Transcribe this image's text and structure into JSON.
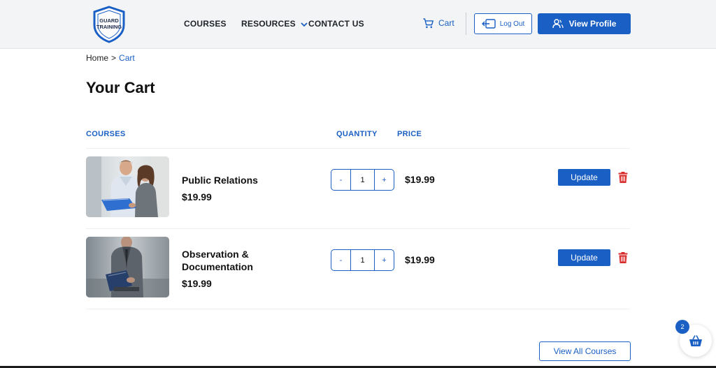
{
  "header": {
    "logo_text_top": "GUARD",
    "logo_text_bottom": "TRAINING",
    "nav": {
      "courses": "COURSES",
      "resources": "RESOURCES",
      "contact": "CONTACT US"
    },
    "cart_label": "Cart",
    "logout_label": "Log Out",
    "profile_label": "View Profile"
  },
  "breadcrumb": {
    "home": "Home",
    "separator": ">",
    "current": "Cart"
  },
  "page_title": "Your Cart",
  "table": {
    "headers": {
      "courses": "COURSES",
      "quantity": "QUANTITY",
      "price": "PRICE"
    },
    "rows": [
      {
        "title": "Public Relations",
        "unit_price": "$19.99",
        "quantity": "1",
        "decrement": "-",
        "increment": "+",
        "price": "$19.99",
        "update_label": "Update"
      },
      {
        "title": "Observation & Documentation",
        "unit_price": "$19.99",
        "quantity": "1",
        "decrement": "-",
        "increment": "+",
        "price": "$19.99",
        "update_label": "Update"
      }
    ]
  },
  "view_all_label": "View All Courses",
  "floating_cart": {
    "count": "2",
    "icon": "basket-icon"
  },
  "colors": {
    "accent": "#1a5fc4",
    "delete": "#d92b2b",
    "header_bg": "#f3f4f5"
  },
  "icons": {
    "cart": "cart-icon",
    "logout": "logout-icon",
    "profile": "user-icon",
    "delete": "trash-icon",
    "dropdown": "chevron-down-icon"
  }
}
